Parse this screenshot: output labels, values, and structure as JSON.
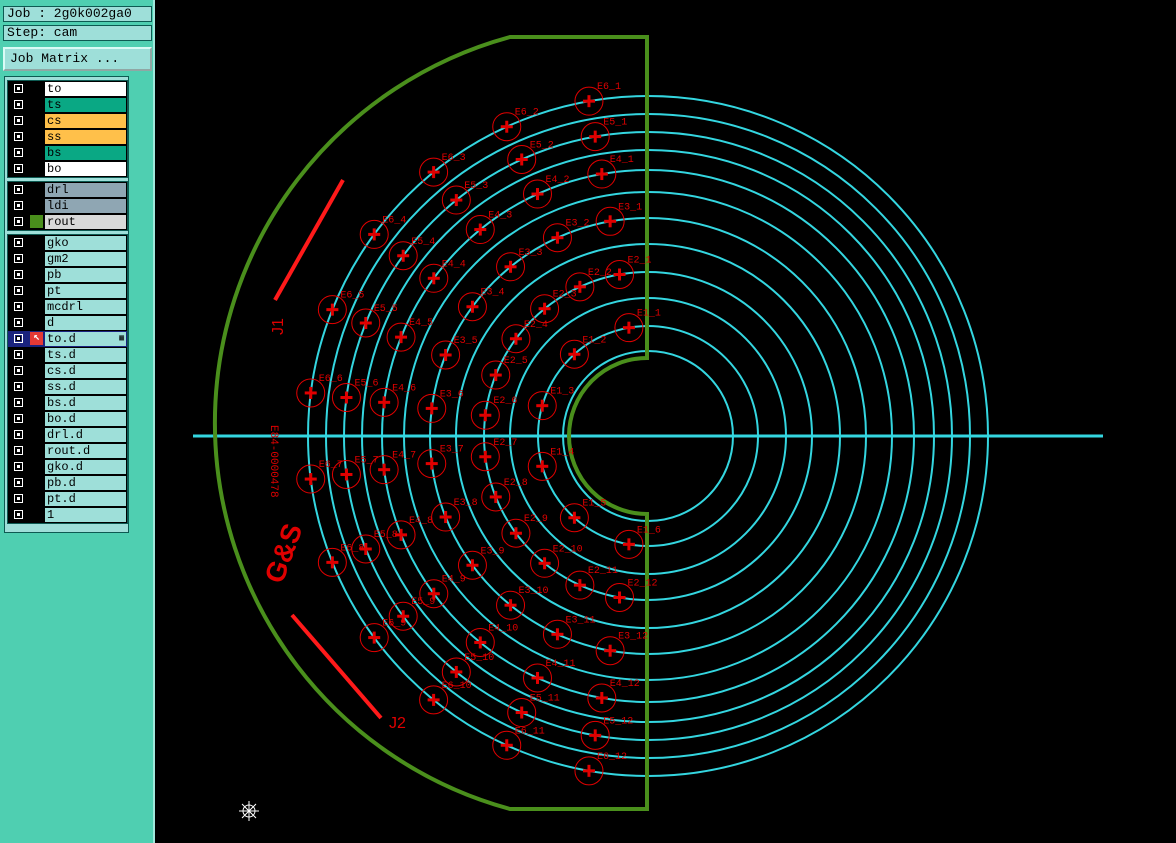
{
  "job": {
    "label": "Job : 2g0k002ga0",
    "step": "Step: cam"
  },
  "job_matrix_button": "Job Matrix ...",
  "layer_groups": [
    [
      {
        "name": "to",
        "color": "#ffffff"
      },
      {
        "name": "ts",
        "color": "#0aa884"
      },
      {
        "name": "cs",
        "color": "#ffc04a"
      },
      {
        "name": "ss",
        "color": "#ffc04a"
      },
      {
        "name": "bs",
        "color": "#0aa884"
      },
      {
        "name": "bo",
        "color": "#ffffff"
      }
    ],
    [
      {
        "name": "drl",
        "color": "#8fa6b3"
      },
      {
        "name": "ldi",
        "color": "#8fa6b3"
      },
      {
        "name": "rout",
        "color": "#d9d9d9",
        "indicator": "green"
      }
    ],
    [
      {
        "name": "gko",
        "color": "#9edfd9"
      },
      {
        "name": "gm2",
        "color": "#9edfd9"
      },
      {
        "name": "pb",
        "color": "#9edfd9"
      },
      {
        "name": "pt",
        "color": "#9edfd9"
      },
      {
        "name": "mcdrl",
        "color": "#9edfd9"
      },
      {
        "name": "d",
        "color": "#9edfd9"
      },
      {
        "name": "to.d",
        "color": "#9edfd9",
        "indicator": "arrow",
        "active": true
      },
      {
        "name": "ts.d",
        "color": "#9edfd9"
      },
      {
        "name": "cs.d",
        "color": "#9edfd9"
      },
      {
        "name": "ss.d",
        "color": "#9edfd9"
      },
      {
        "name": "bs.d",
        "color": "#9edfd9"
      },
      {
        "name": "bo.d",
        "color": "#9edfd9"
      },
      {
        "name": "drl.d",
        "color": "#9edfd9"
      },
      {
        "name": "rout.d",
        "color": "#9edfd9"
      },
      {
        "name": "gko.d",
        "color": "#9edfd9"
      },
      {
        "name": "pb.d",
        "color": "#9edfd9"
      },
      {
        "name": "pt.d",
        "color": "#9edfd9"
      },
      {
        "name": "1",
        "color": "#9edfd9"
      }
    ]
  ],
  "board_labels": {
    "j1": "J1",
    "j2": "J2",
    "part_no": "E84-0000478",
    "logo": "G&S"
  },
  "pad_labels": [
    "E3_1",
    "E3_2",
    "E3_3",
    "E3_4",
    "E3_5",
    "E3_6",
    "E3_7",
    "E3_8",
    "E3_9",
    "E3_10",
    "E3_11",
    "E3_12",
    "E5_1",
    "E5_2",
    "E5_3",
    "E5_4",
    "E5_5",
    "E5_6",
    "E5_7",
    "E5_8",
    "E5_9",
    "E5_10",
    "E5_11",
    "E5_12",
    "E2_1",
    "E2_2",
    "E2_3",
    "E2_4",
    "E2_5",
    "E2_6",
    "E2_7",
    "E2_8",
    "E2_9",
    "E2_10",
    "E2_11",
    "E2_12",
    "E1_1",
    "E1_2",
    "E1_3",
    "E1_4",
    "E1_5",
    "E1_6",
    "E4_1",
    "E4_2",
    "E4_3",
    "E4_4",
    "E4_5",
    "E4_6",
    "E4_7",
    "E4_8",
    "E4_9",
    "E4_10",
    "E4_11",
    "E4_12",
    "E6_1",
    "E6_2",
    "E6_3",
    "E6_4",
    "E6_5",
    "E6_6",
    "E6_7",
    "E6_8",
    "E6_9",
    "E6_10",
    "E6_11",
    "E6_12"
  ],
  "colors": {
    "outline": "#4a8f1c",
    "rings": "#34d6e0",
    "pads": "#e00000",
    "sidebar_bg": "#4fcfb1"
  },
  "icons": {
    "origin": "crosshair-origin-icon"
  }
}
